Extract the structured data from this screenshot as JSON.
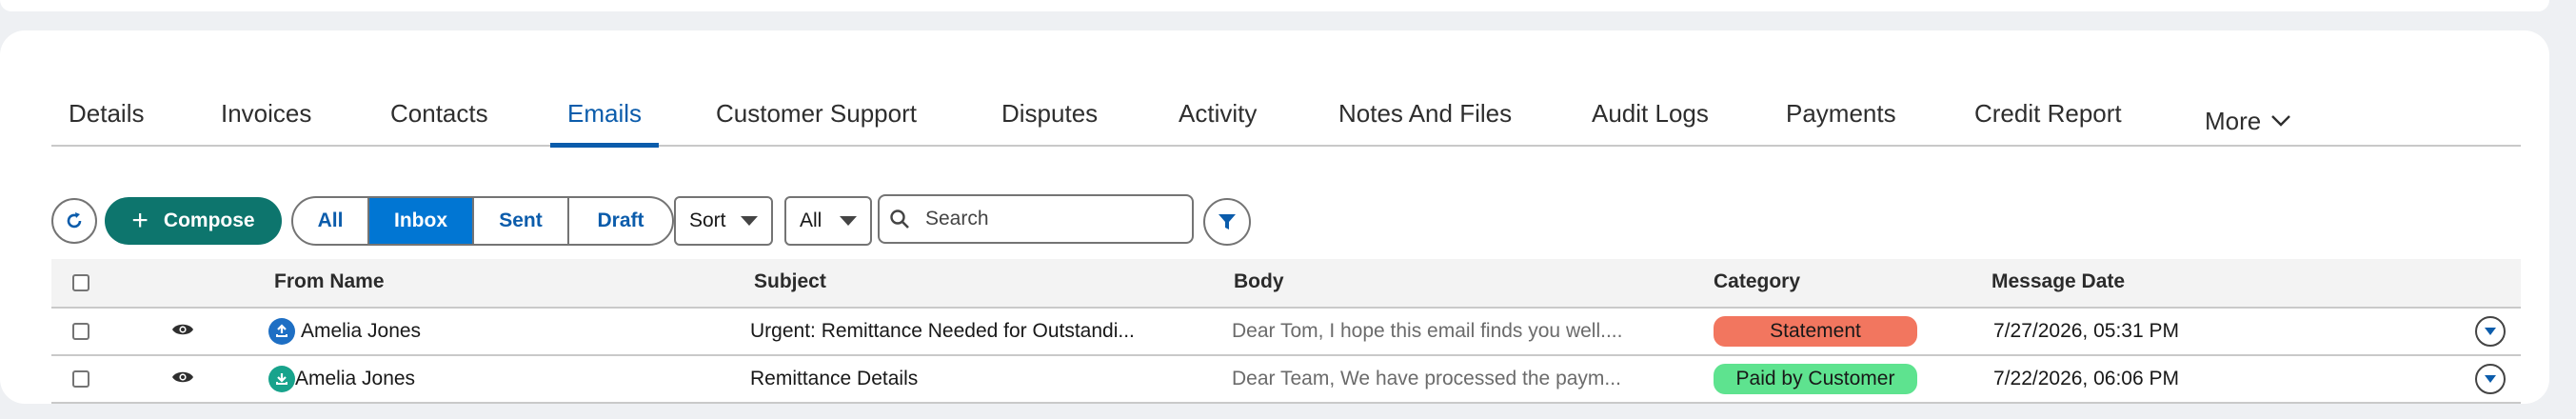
{
  "tabs": [
    {
      "label": "Details"
    },
    {
      "label": "Invoices"
    },
    {
      "label": "Contacts"
    },
    {
      "label": "Emails"
    },
    {
      "label": "Customer Support"
    },
    {
      "label": "Disputes"
    },
    {
      "label": "Activity"
    },
    {
      "label": "Notes And Files"
    },
    {
      "label": "Audit Logs"
    },
    {
      "label": "Payments"
    },
    {
      "label": "Credit Report"
    },
    {
      "label": "More"
    }
  ],
  "active_tab": "Emails",
  "toolbar": {
    "compose_label": "Compose",
    "filters": [
      {
        "label": "All"
      },
      {
        "label": "Inbox"
      },
      {
        "label": "Sent"
      },
      {
        "label": "Draft"
      }
    ],
    "selected_filter": "Inbox",
    "sort_label": "Sort",
    "type_select_value": "All",
    "search_placeholder": "Search"
  },
  "table": {
    "columns": {
      "from_name": "From Name",
      "subject": "Subject",
      "body": "Body",
      "category": "Category",
      "message_date": "Message Date"
    },
    "rows": [
      {
        "direction_icon": "upload-icon",
        "from_name": "Amelia Jones",
        "subject": "Urgent: Remittance Needed for Outstandi...",
        "body": "Dear Tom, I hope this email finds you well....",
        "category": "Statement",
        "category_color": "#f2765f",
        "message_date": "7/27/2026, 05:31 PM"
      },
      {
        "direction_icon": "download-icon",
        "from_name": "Amelia Jones",
        "subject": "Remittance Details",
        "body": "Dear Team, We have processed the paym...",
        "category": "Paid by Customer",
        "category_color": "#5ee38f",
        "message_date": "7/22/2026, 06:06 PM"
      }
    ]
  },
  "colors": {
    "accent": "#0b5cab",
    "brand_button": "#0176d3",
    "compose": "#0d756d",
    "upload_icon": "#1e6fc4",
    "download_icon": "#18a38c"
  }
}
